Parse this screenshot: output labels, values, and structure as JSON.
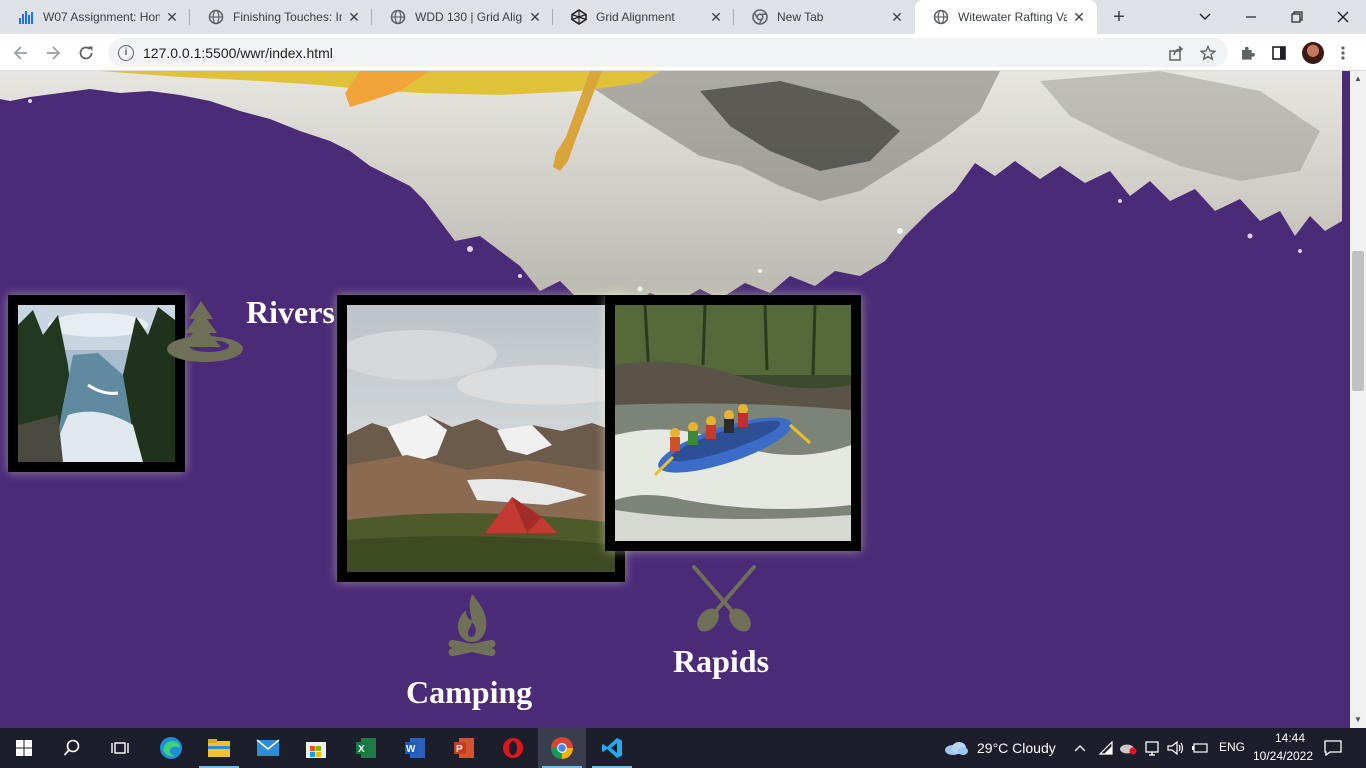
{
  "browser": {
    "tabs": [
      {
        "title": "W07 Assignment: Hon",
        "icon": "chart-icon",
        "active": false
      },
      {
        "title": "Finishing Touches: Inst",
        "icon": "globe-icon",
        "active": false
      },
      {
        "title": "WDD 130 | Grid Align",
        "icon": "globe-icon",
        "active": false
      },
      {
        "title": "Grid Alignment",
        "icon": "codepen-icon",
        "active": false
      },
      {
        "title": "New Tab",
        "icon": "chrome-icon",
        "active": false
      },
      {
        "title": "Witewater Rafting Vac",
        "icon": "globe-icon",
        "active": true
      }
    ],
    "url": "127.0.0.1:5500/wwr/index.html"
  },
  "page": {
    "background_color": "#4b2a78",
    "icon_color": "#6f7058",
    "features": {
      "rivers": "Rivers",
      "camping": "Camping",
      "rapids": "Rapids"
    }
  },
  "taskbar": {
    "weather": "29°C  Cloudy",
    "language": "ENG",
    "time": "14:44",
    "date": "10/24/2022"
  }
}
